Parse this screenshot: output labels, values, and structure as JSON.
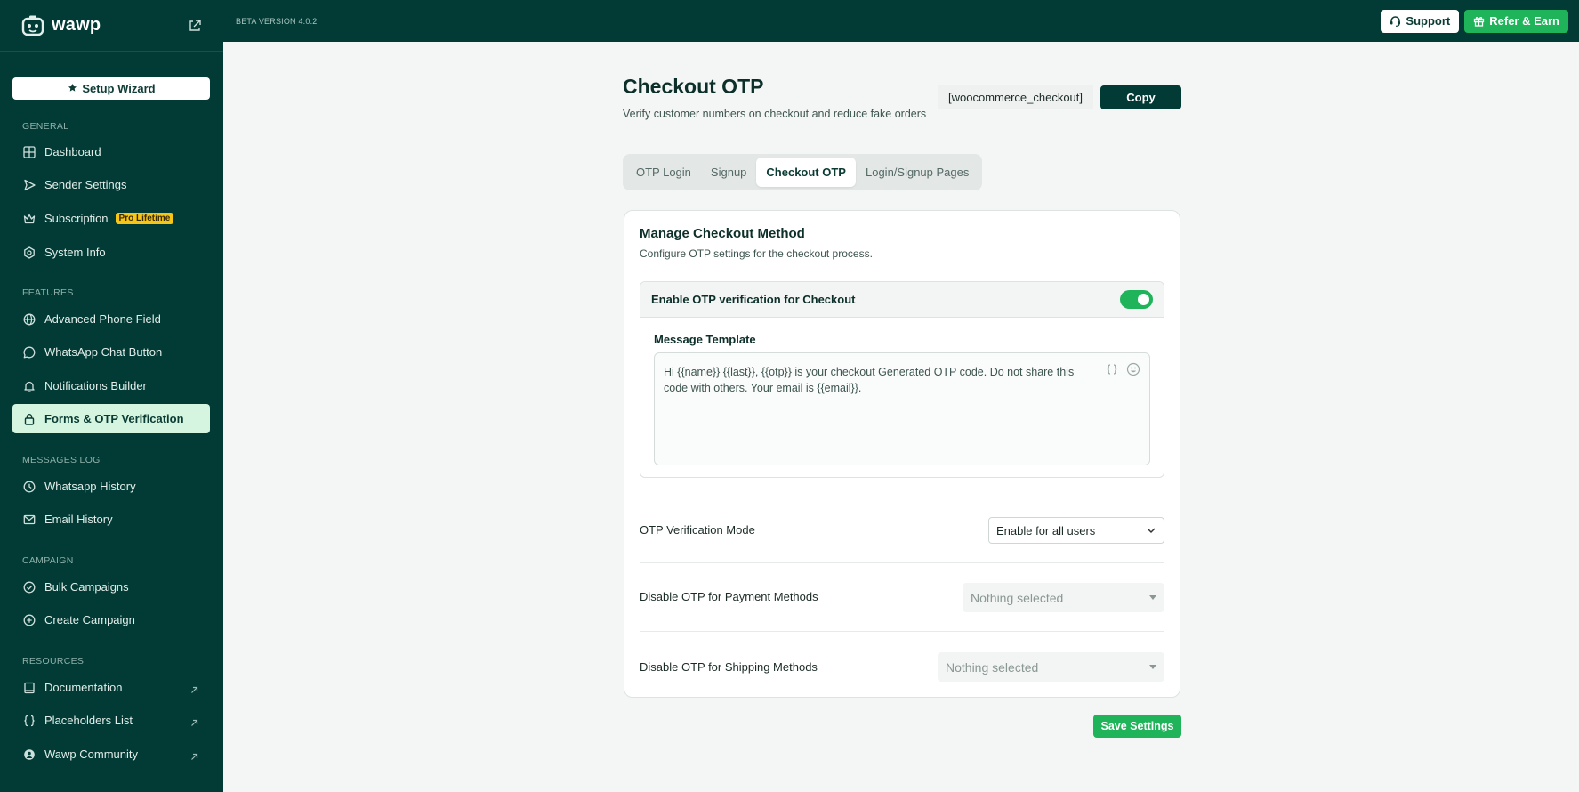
{
  "brand": {
    "name": "wawp"
  },
  "sidebar": {
    "setup_wizard": "Setup Wizard",
    "sections": [
      {
        "label": "GENERAL"
      },
      {
        "label": "FEATURES"
      },
      {
        "label": "MESSAGES LOG"
      },
      {
        "label": "CAMPAIGN"
      },
      {
        "label": "RESOURCES"
      }
    ],
    "items": [
      {
        "label": "Dashboard",
        "icon": "grid-icon"
      },
      {
        "label": "Sender Settings",
        "icon": "send-icon"
      },
      {
        "label": "Subscription",
        "icon": "crown-icon",
        "badge": "Pro Lifetime"
      },
      {
        "label": "System Info",
        "icon": "settings-icon"
      },
      {
        "label": "Advanced Phone Field",
        "icon": "globe-icon"
      },
      {
        "label": "WhatsApp Chat Button",
        "icon": "whatsapp-icon"
      },
      {
        "label": "Notifications Builder",
        "icon": "bell-icon"
      },
      {
        "label": "Forms & OTP Verification",
        "icon": "lock-icon",
        "active": true
      },
      {
        "label": "Whatsapp History",
        "icon": "history-icon"
      },
      {
        "label": "Email History",
        "icon": "mail-icon"
      },
      {
        "label": "Bulk Campaigns",
        "icon": "check-circle-icon"
      },
      {
        "label": "Create Campaign",
        "icon": "plus-circle-icon"
      },
      {
        "label": "Documentation",
        "icon": "book-icon",
        "external": true
      },
      {
        "label": "Placeholders List",
        "icon": "braces-icon",
        "external": true
      },
      {
        "label": "Wawp Community",
        "icon": "community-icon",
        "external": true
      }
    ]
  },
  "topbar": {
    "version": "BETA VERSION 4.0.2",
    "support_label": "Support",
    "refer_label": "Refer & Earn"
  },
  "header": {
    "title": "Checkout OTP",
    "subtitle": "Verify customer numbers on checkout and reduce fake orders",
    "shortcode": "[woocommerce_checkout]",
    "copy_label": "Copy"
  },
  "tabs": [
    {
      "label": "OTP Login"
    },
    {
      "label": "Signup"
    },
    {
      "label": "Checkout OTP",
      "active": true
    },
    {
      "label": "Login/Signup Pages"
    }
  ],
  "card": {
    "title": "Manage Checkout Method",
    "subtitle": "Configure OTP settings for the checkout process.",
    "enable_label": "Enable OTP verification for Checkout",
    "enable_on": true,
    "template_label": "Message Template",
    "template_text": "Hi {{name}} {{last}}, {{otp}} is your checkout Generated OTP code. Do not share this code with others. Your email is {{email}}.",
    "mode_label": "OTP Verification Mode",
    "mode_value": "Enable for all users",
    "payment_label": "Disable OTP for Payment Methods",
    "payment_value": "Nothing selected",
    "shipping_label": "Disable OTP for Shipping Methods",
    "shipping_value": "Nothing selected"
  },
  "save_label": "Save Settings",
  "colors": {
    "sidebar_bg": "#023b35",
    "accent": "#1fb35a",
    "active_bg": "#d5f5e1",
    "badge": "#f5c518"
  }
}
